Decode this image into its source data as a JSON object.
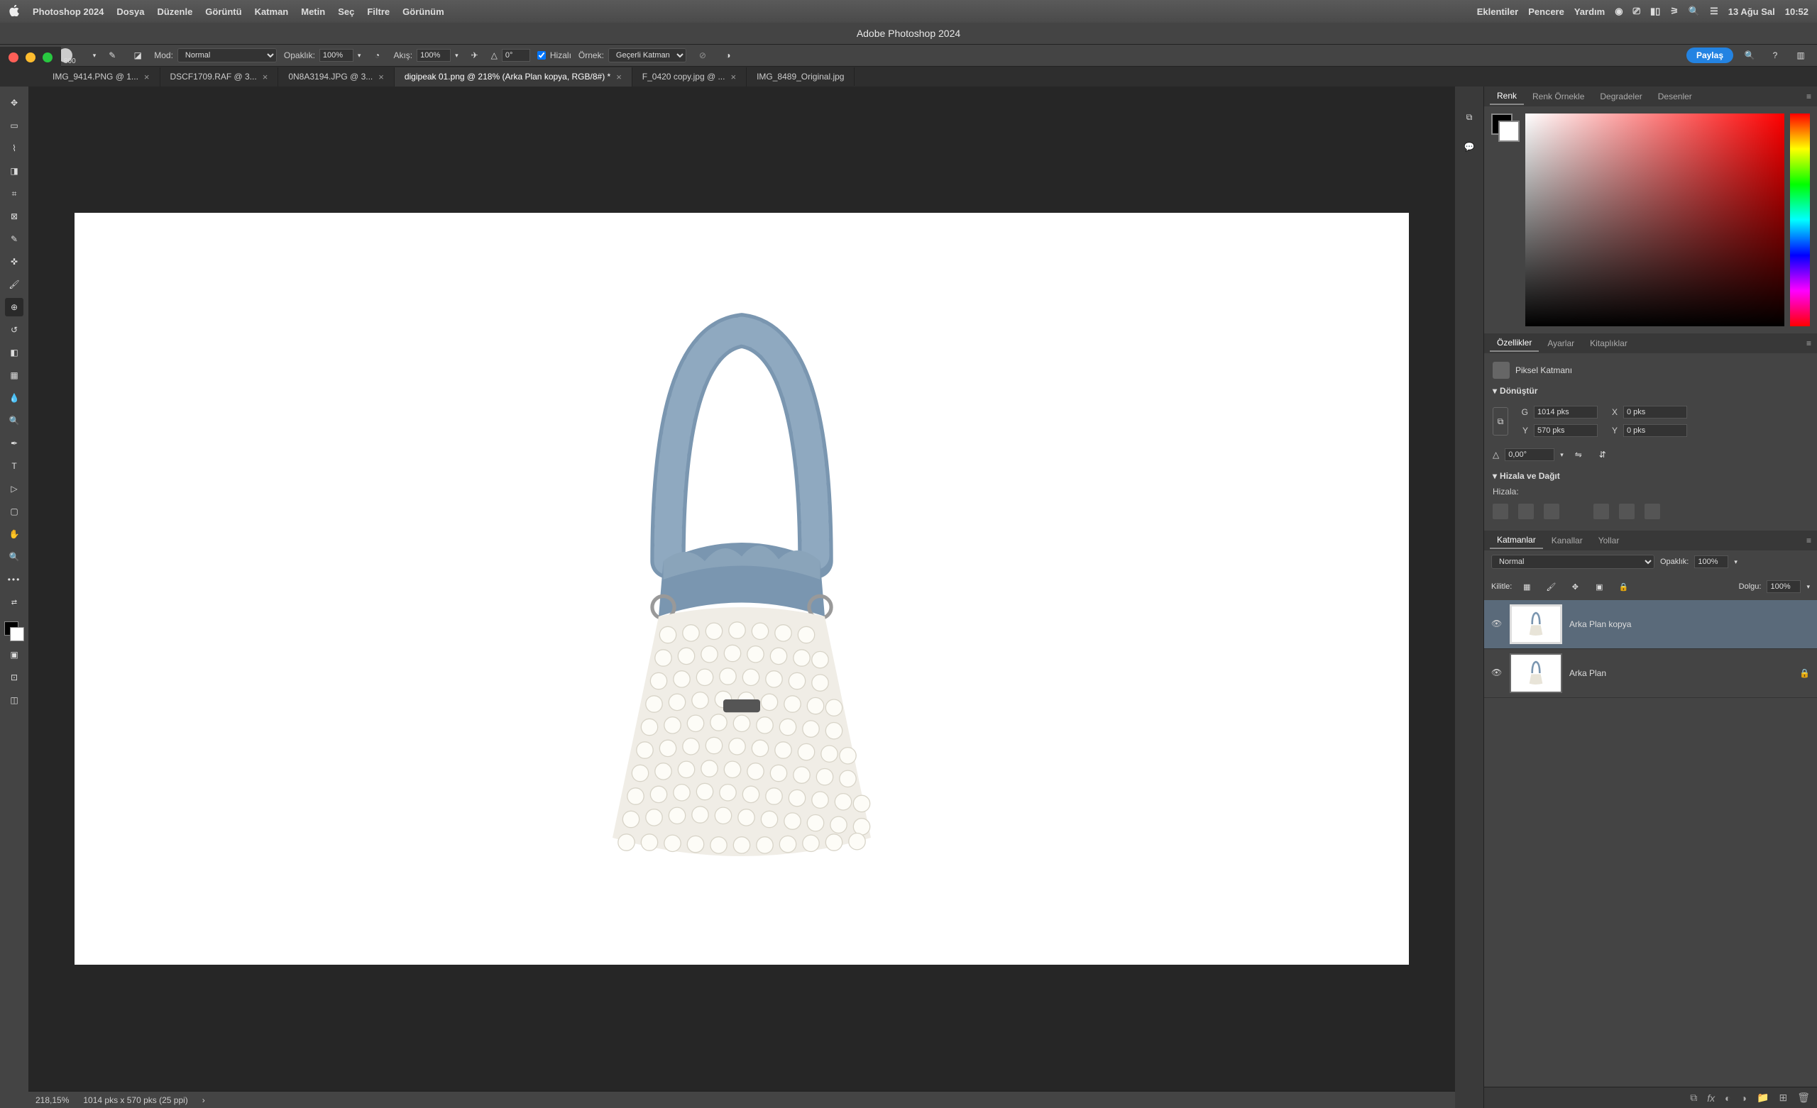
{
  "menubar": {
    "app": "Photoshop 2024",
    "items": [
      "Dosya",
      "Düzenle",
      "Görüntü",
      "Katman",
      "Metin",
      "Seç",
      "Filtre",
      "Görünüm"
    ],
    "right_items": [
      "Eklentiler",
      "Pencere",
      "Yardım"
    ],
    "date": "13 Ağu Sal",
    "time": "10:52"
  },
  "titlebar": {
    "title": "Adobe Photoshop 2024"
  },
  "options": {
    "brush_size": "800",
    "mode_label": "Mod:",
    "mode_value": "Normal",
    "opacity_label": "Opaklık:",
    "opacity_value": "100%",
    "flow_label": "Akış:",
    "flow_value": "100%",
    "angle_value": "0°",
    "smooth_label": "Hizalı",
    "sample_label": "Örnek:",
    "sample_value": "Geçerli Katman",
    "share": "Paylaş"
  },
  "tabs": [
    {
      "label": "IMG_9414.PNG @ 1..."
    },
    {
      "label": "DSCF1709.RAF @ 3..."
    },
    {
      "label": "0N8A3194.JPG @ 3..."
    },
    {
      "label": "digipeak 01.png @ 218% (Arka Plan kopya, RGB/8#) *",
      "active": true
    },
    {
      "label": "F_0420 copy.jpg @ ..."
    },
    {
      "label": "IMG_8489_Original.jpg"
    }
  ],
  "status": {
    "zoom": "218,15%",
    "dims": "1014 pks x 570 pks (25 ppi)"
  },
  "color_tabs": [
    "Renk",
    "Renk Örnekle",
    "Degradeler",
    "Desenler"
  ],
  "props_tabs": [
    "Özellikler",
    "Ayarlar",
    "Kitaplıklar"
  ],
  "props": {
    "layer_type": "Piksel Katmanı",
    "transform": "Dönüştür",
    "g_label": "G",
    "g_value": "1014 pks",
    "x_label": "X",
    "x_value": "0 pks",
    "y_label": "Y",
    "y_value": "570 pks",
    "y2_label": "Y",
    "y2_value": "0 pks",
    "angle": "0,00°",
    "align_distribute": "Hizala ve Dağıt",
    "align_label": "Hizala:"
  },
  "layers_tabs": [
    "Katmanlar",
    "Kanallar",
    "Yollar"
  ],
  "layers": {
    "blend_mode": "Normal",
    "opacity_label": "Opaklık:",
    "opacity_value": "100%",
    "lock_label": "Kilitle:",
    "fill_label": "Dolgu:",
    "fill_value": "100%",
    "items": [
      {
        "name": "Arka Plan kopya",
        "locked": false
      },
      {
        "name": "Arka Plan",
        "locked": true
      }
    ]
  }
}
